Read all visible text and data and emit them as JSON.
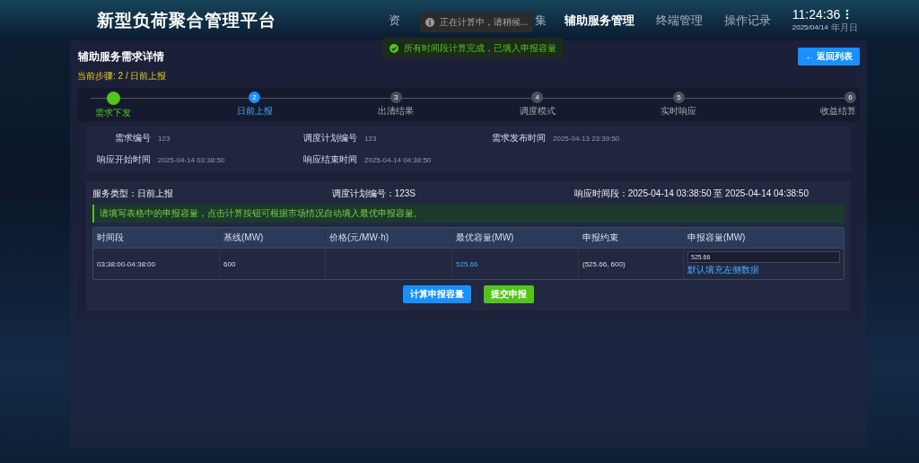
{
  "header": {
    "title": "新型负荷聚合管理平台",
    "nav": [
      {
        "label_parts": [
          "资",
          "集"
        ],
        "selected": false
      },
      {
        "label_parts": [
          "辅助服务管理"
        ],
        "selected": true
      },
      {
        "label_parts": [
          "终端管理"
        ],
        "selected": false
      },
      {
        "label_parts": [
          "操作记录"
        ],
        "selected": false
      }
    ],
    "clock": {
      "time": "11:24:36",
      "date": "2025/04/14",
      "date_unit": "年月日"
    }
  },
  "toasts": [
    {
      "kind": "info",
      "text": "正在计算中，请稍候..."
    },
    {
      "kind": "success",
      "text": "所有时间段计算完成，已填入申报容量"
    }
  ],
  "page": {
    "title": "辅助服务需求详情",
    "back_button": "← 返回列表",
    "current_step": "当前步骤: 2 / 日前上报",
    "steps": [
      {
        "label": "需求下发",
        "completed": true,
        "selected": false
      },
      {
        "number": "2",
        "label": "日前上报",
        "completed": false,
        "selected": true
      },
      {
        "number": "3",
        "label": "出清结果",
        "completed": false,
        "selected": false
      },
      {
        "number": "4",
        "label": "调度模式",
        "completed": false,
        "selected": false
      },
      {
        "number": "5",
        "label": "实时响应",
        "completed": false,
        "selected": false
      },
      {
        "number": "6",
        "label": "收益结算",
        "completed": false,
        "selected": false
      }
    ],
    "info": [
      {
        "label": "需求编号",
        "value": "123"
      },
      {
        "label": "调度计划编号",
        "value": "123"
      },
      {
        "label": "需求发布时间",
        "value": "2025-04-13 23:39:50"
      },
      {
        "label": "响应开始时间",
        "value": "2025-04-14 03:38:50"
      },
      {
        "label": "响应结束时间",
        "value": "2025-04-14 04:38:50"
      }
    ],
    "report": {
      "service_type": "服务类型：日前上报",
      "plan_no": "调度计划编号：123S",
      "period": "响应时间段：2025-04-14 03:38:50 至 2025-04-14 04:38:50",
      "tip": "请填写表格中的申报容量，点击计算按钮可根据市场情况自动填入最优申报容量。",
      "table": {
        "columns": [
          "时间段",
          "基线(MW)",
          "价格(元/MW·h)",
          "最优容量(MW)",
          "申报约束",
          "申报容量(MW)"
        ],
        "rows": [
          {
            "time": "03:38:00-04:38:00",
            "baseline": "600",
            "optimal": "525.66",
            "constraint": "(525.66, 600)",
            "capacity": "525.66",
            "fill_link": "默认填充左侧数据"
          }
        ]
      },
      "buttons": [
        {
          "kind": "primary",
          "label": "计算申报容量"
        },
        {
          "kind": "success",
          "label": "提交申报"
        }
      ]
    }
  }
}
